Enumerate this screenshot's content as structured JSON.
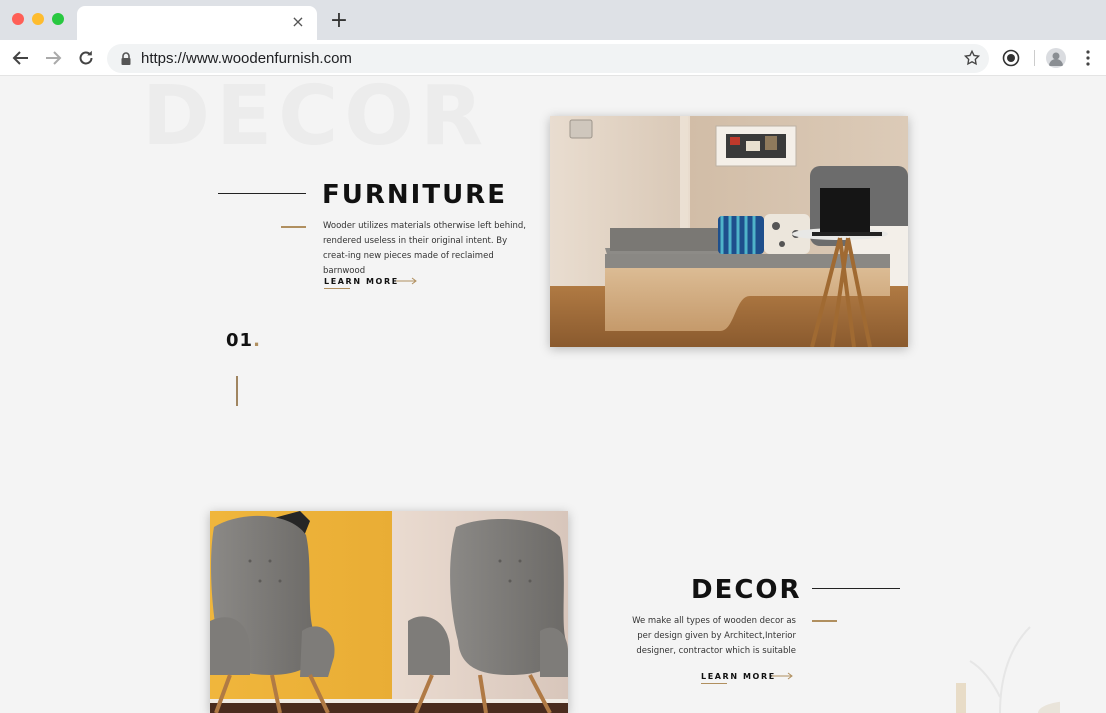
{
  "browser": {
    "url": "https://www.woodenfurnish.com",
    "tab_close": "×",
    "new_tab": "+"
  },
  "page": {
    "background_word": "DECOR",
    "section1": {
      "title": "FURNITURE",
      "description": "Wooder utilizes materials otherwise left behind, rendered useless in their original intent. By creat-ing new pieces made of reclaimed barnwood",
      "learn_more": "LEARN MORE",
      "number": "01",
      "number_dot": "."
    },
    "section2": {
      "title": "DECOR",
      "description": "We make all types of wooden decor as per design given by Architect,Interior designer, contractor which is suitable",
      "learn_more": "LEARN MORE"
    }
  },
  "colors": {
    "accent": "#b08f5f",
    "tab_bar": "#dee1e6",
    "page_bg": "#f4f4f4"
  }
}
